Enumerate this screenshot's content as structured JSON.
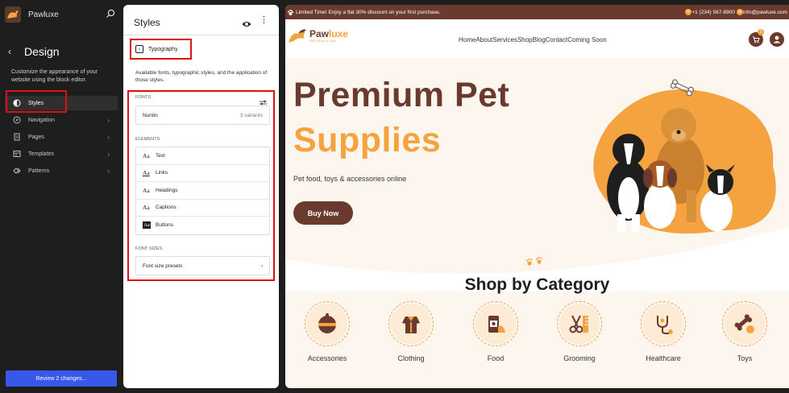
{
  "sidebar": {
    "site_name": "Pawluxe",
    "design_title": "Design",
    "design_description": "Customize the appearance of your website using the block editor.",
    "nav": [
      {
        "label": "Styles",
        "icon": "half-circle-icon",
        "active": true
      },
      {
        "label": "Navigation",
        "icon": "compass-icon"
      },
      {
        "label": "Pages",
        "icon": "page-icon"
      },
      {
        "label": "Templates",
        "icon": "layout-icon"
      },
      {
        "label": "Patterns",
        "icon": "diamond-icon"
      }
    ],
    "review_button": "Review 2 changes..."
  },
  "panel": {
    "title": "Styles",
    "back_label": "Typography",
    "description": "Available fonts, typographic styles, and the application of those styles.",
    "fonts_label": "FONTS",
    "font": {
      "name": "Nunito",
      "variants": "3 variants"
    },
    "elements_label": "ELEMENTS",
    "elements": [
      {
        "label": "Text",
        "sample": "Aa"
      },
      {
        "label": "Links",
        "sample": "Aa"
      },
      {
        "label": "Headings",
        "sample": "Aa"
      },
      {
        "label": "Captions",
        "sample": "Aa"
      },
      {
        "label": "Buttons",
        "sample": "Aa"
      }
    ],
    "font_sizes_label": "FONT SIZES",
    "font_size_presets": "Font size presets"
  },
  "preview": {
    "promo": "Limited Time! Enjoy a flat 30% discount on your first purchase.",
    "phone": "+1 (234) 567-8900",
    "email": "info@pawluxe.com",
    "logo": {
      "part1": "Paw",
      "part2": "luxe",
      "tagline": "Pet's Shop & Care"
    },
    "menu": [
      "Home",
      "About",
      "Services",
      "Shop",
      "Blog",
      "Contact",
      "Coming Soon"
    ],
    "cart_count": "2",
    "hero_line1": "Premium Pet",
    "hero_line2": "Supplies",
    "hero_sub": "Pet food, toys & accessories online",
    "buy_button": "Buy Now",
    "category_title": "Shop by Category",
    "categories": [
      {
        "label": "Accessories",
        "icon": "bell-icon"
      },
      {
        "label": "Clothing",
        "icon": "jacket-icon"
      },
      {
        "label": "Food",
        "icon": "food-can-icon"
      },
      {
        "label": "Grooming",
        "icon": "scissors-comb-icon"
      },
      {
        "label": "Healthcare",
        "icon": "stethoscope-icon"
      },
      {
        "label": "Toys",
        "icon": "bone-ball-icon"
      }
    ]
  },
  "colors": {
    "brand_brown": "#6b3a2e",
    "brand_orange": "#f5a340",
    "wp_blue": "#3858e9",
    "highlight_red": "#dd1111"
  }
}
